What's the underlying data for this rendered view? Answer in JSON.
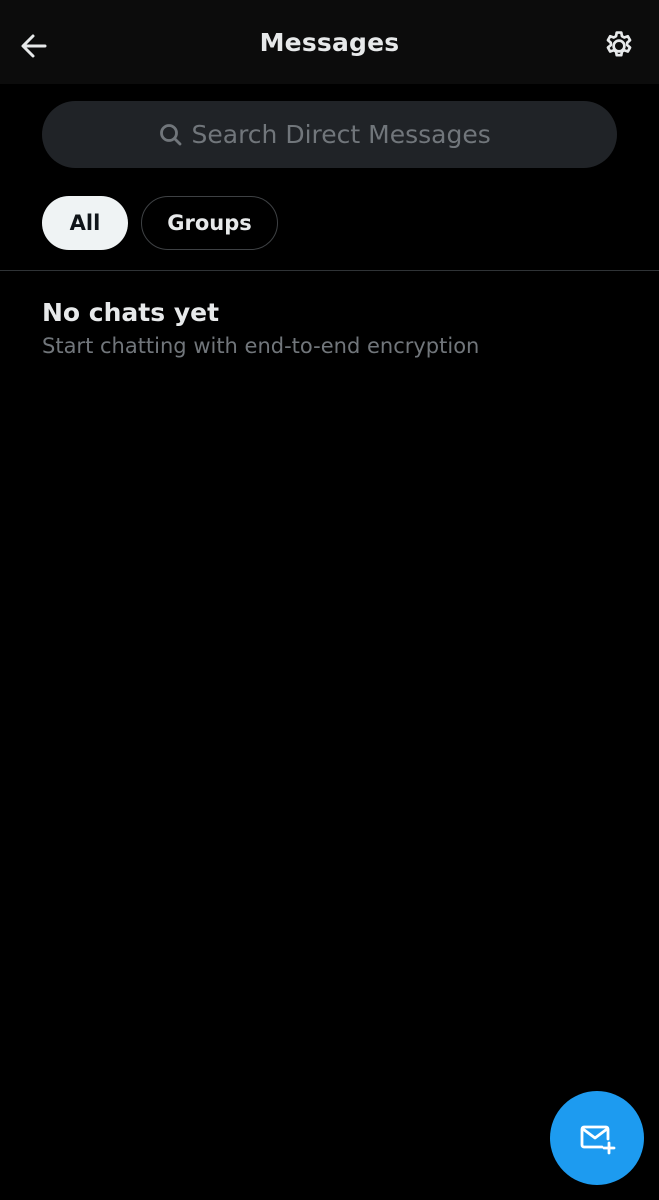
{
  "header": {
    "title": "Messages",
    "back_icon": "arrow-left-icon",
    "settings_icon": "gear-icon"
  },
  "search": {
    "placeholder": "Search Direct Messages",
    "value": "",
    "icon": "search-icon"
  },
  "filters": {
    "items": [
      {
        "label": "All",
        "selected": true
      },
      {
        "label": "Groups",
        "selected": false
      }
    ]
  },
  "empty_state": {
    "title": "No chats yet",
    "subtitle": "Start chatting with end-to-end encryption"
  },
  "fab": {
    "icon": "new-message-icon"
  },
  "colors": {
    "background": "#000000",
    "header_background": "#0c0c0c",
    "search_background": "#202327",
    "primary_text": "#e7e9ea",
    "secondary_text": "#71767b",
    "accent": "#1d9bf0",
    "chip_selected_background": "#eff3f4",
    "divider": "#2f3336"
  }
}
